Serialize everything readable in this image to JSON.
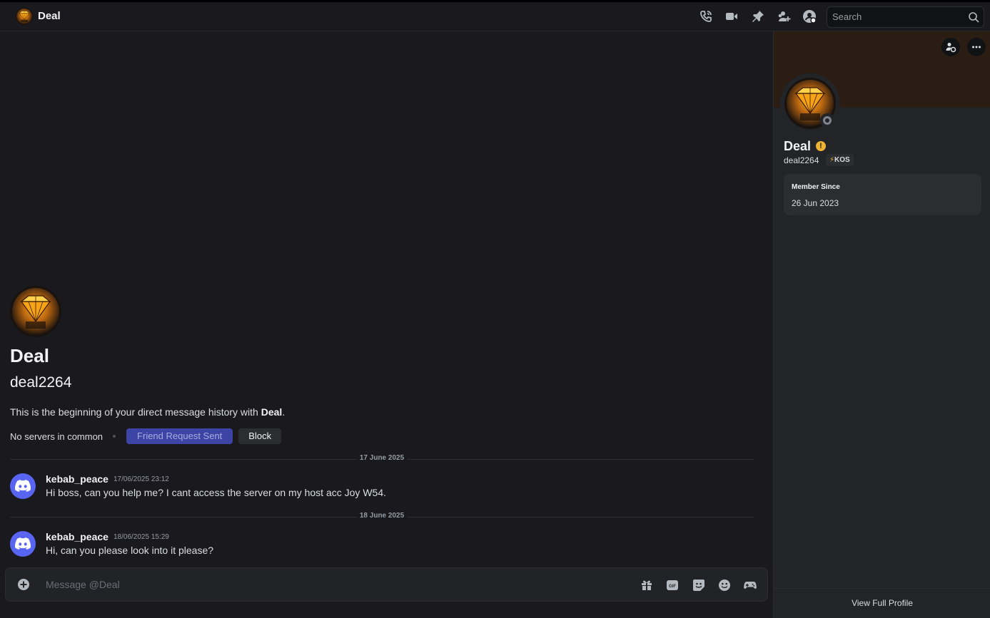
{
  "header": {
    "title": "Deal",
    "icons": [
      "phone-icon",
      "video-icon",
      "pin-icon",
      "add-friend-icon",
      "user-profile-icon"
    ],
    "search_placeholder": "Search"
  },
  "intro": {
    "name": "Deal",
    "handle": "deal2264",
    "text_prefix": "This is the beginning of your direct message history with ",
    "text_name": "Deal",
    "text_suffix": ".",
    "servers": "No servers in common",
    "friend_button": "Friend Request Sent",
    "block_button": "Block"
  },
  "dividers": [
    {
      "label": "17 June 2025"
    },
    {
      "label": "18 June 2025"
    }
  ],
  "messages": [
    {
      "author": "kebab_peace",
      "timestamp": "17/06/2025 23:12",
      "text": "Hi boss, can you help me? I cant access the server on my host acc Joy W54."
    },
    {
      "author": "kebab_peace",
      "timestamp": "18/06/2025 15:29",
      "text": "Hi, can you please look into it please?"
    }
  ],
  "composer": {
    "placeholder": "Message @Deal",
    "icons": [
      "gift-icon",
      "gif-icon",
      "sticker-icon",
      "emoji-icon",
      "game-controller-icon"
    ]
  },
  "profile": {
    "name": "Deal",
    "handle": "deal2264",
    "tag": "KOS",
    "member_since_label": "Member Since",
    "member_since": "26 Jun 2023",
    "footer": "View Full Profile",
    "status": "offline"
  },
  "colors": {
    "accent": "#5865f2",
    "friend_button": "#3c45a5",
    "warning": "#f0b232",
    "background": "#1a1a1e",
    "panel": "#232428"
  }
}
